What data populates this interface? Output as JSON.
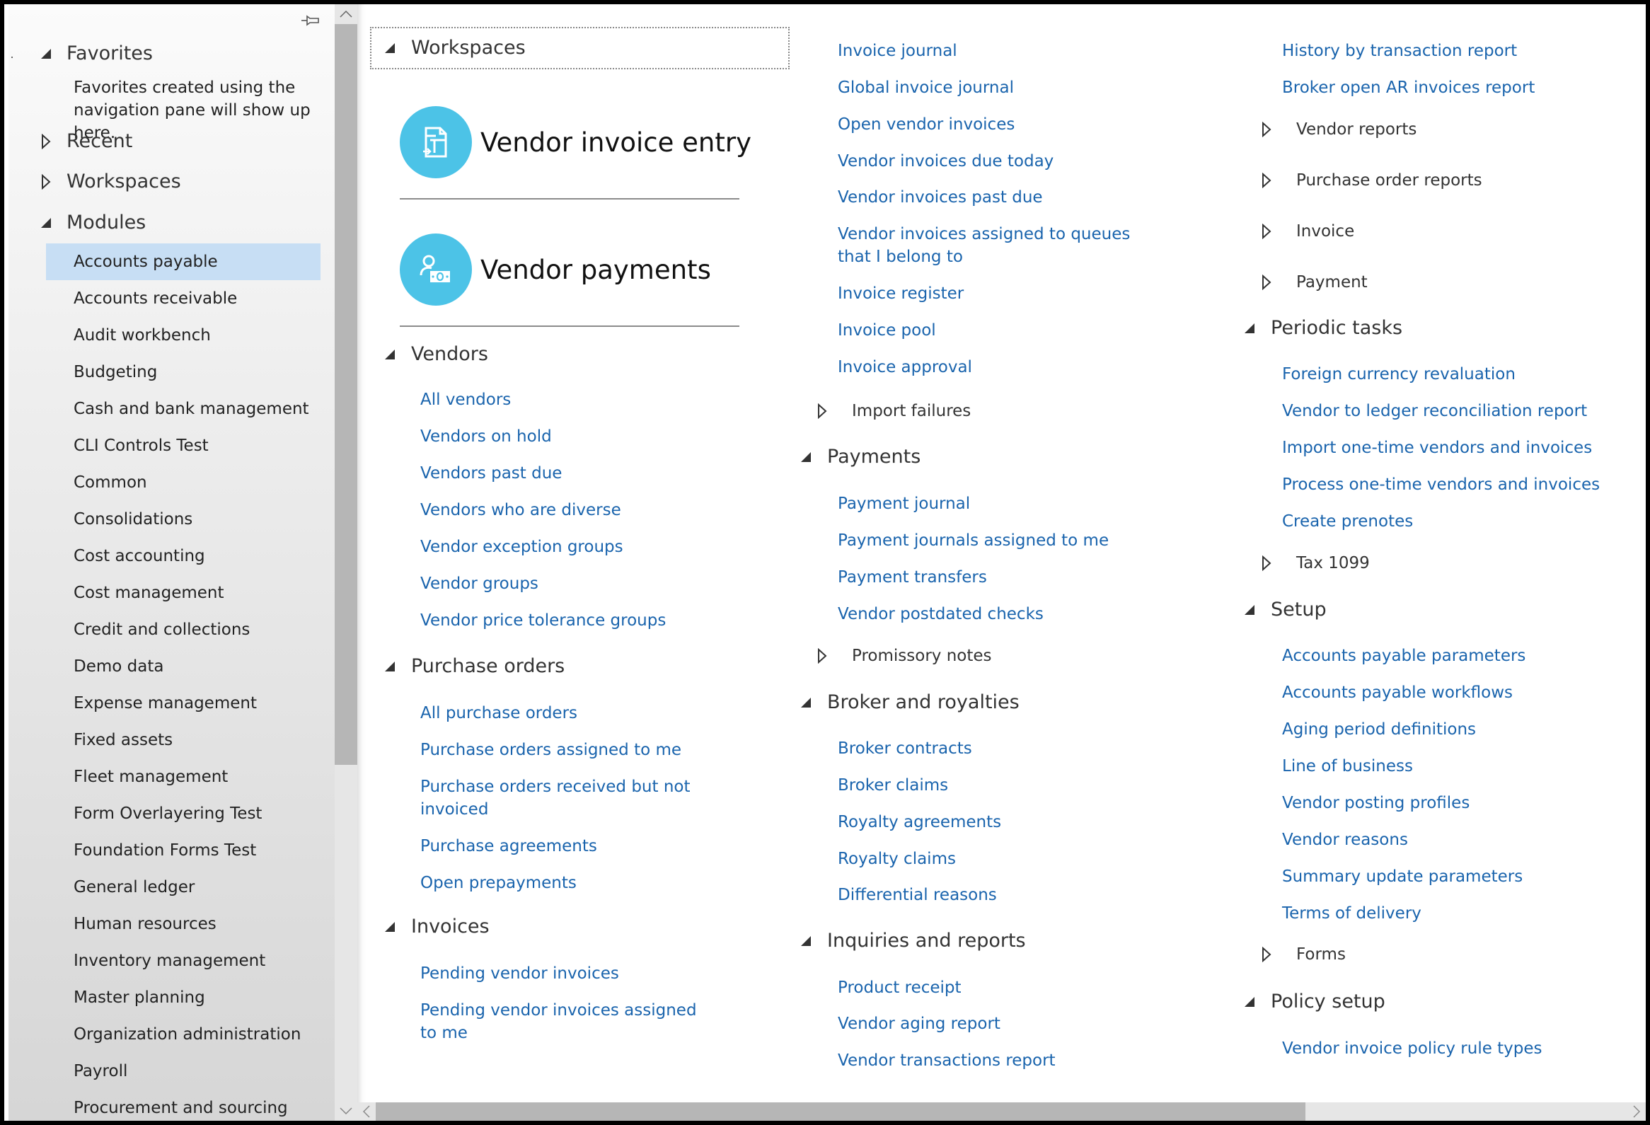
{
  "nav": {
    "pin_icon": "pin-icon",
    "sections": {
      "favorites": {
        "label": "Favorites",
        "expanded": true,
        "hint": "Favorites created using the navigation pane will show up here."
      },
      "recent": {
        "label": "Recent",
        "expanded": false
      },
      "workspaces": {
        "label": "Workspaces",
        "expanded": false
      },
      "modules": {
        "label": "Modules",
        "expanded": true
      }
    },
    "selected_module": "Accounts payable",
    "modules": [
      "Accounts payable",
      "Accounts receivable",
      "Audit workbench",
      "Budgeting",
      "Cash and bank management",
      "CLI Controls Test",
      "Common",
      "Consolidations",
      "Cost accounting",
      "Cost management",
      "Credit and collections",
      "Demo data",
      "Expense management",
      "Fixed assets",
      "Fleet management",
      "Form Overlayering Test",
      "Foundation Forms Test",
      "General ledger",
      "Human resources",
      "Inventory management",
      "Master planning",
      "Organization administration",
      "Payroll",
      "Procurement and sourcing"
    ]
  },
  "main": {
    "workspaces": {
      "label": "Workspaces",
      "tiles": [
        {
          "label": "Vendor invoice entry",
          "icon": "invoice-entry-icon"
        },
        {
          "label": "Vendor payments",
          "icon": "vendor-payment-icon"
        }
      ]
    },
    "vendors": {
      "label": "Vendors",
      "links": [
        "All vendors",
        "Vendors on hold",
        "Vendors past due",
        "Vendors who are diverse",
        "Vendor exception groups",
        "Vendor groups",
        "Vendor price tolerance groups"
      ]
    },
    "purchase_orders": {
      "label": "Purchase orders",
      "links": [
        "All purchase orders",
        "Purchase orders assigned to me",
        "Purchase orders received but not invoiced",
        "Purchase agreements",
        "Open prepayments"
      ]
    },
    "invoices": {
      "label": "Invoices",
      "links": [
        "Pending vendor invoices",
        "Pending vendor invoices assigned to me"
      ]
    },
    "invoices_cont": {
      "links": [
        "Invoice journal",
        "Global invoice journal",
        "Open vendor invoices",
        "Vendor invoices due today",
        "Vendor invoices past due",
        "Vendor invoices assigned to queues that I belong to",
        "Invoice register",
        "Invoice pool",
        "Invoice approval"
      ],
      "subgroups": [
        "Import failures"
      ]
    },
    "payments": {
      "label": "Payments",
      "links": [
        "Payment journal",
        "Payment journals assigned to me",
        "Payment transfers",
        "Vendor postdated checks"
      ],
      "subgroups": [
        "Promissory notes"
      ]
    },
    "broker": {
      "label": "Broker and royalties",
      "links": [
        "Broker contracts",
        "Broker claims",
        "Royalty agreements",
        "Royalty claims",
        "Differential reasons"
      ]
    },
    "inquiries": {
      "label": "Inquiries and reports",
      "links": [
        "Product receipt",
        "Vendor aging report",
        "Vendor transactions report"
      ]
    },
    "inquiries_cont": {
      "links": [
        "History by transaction report",
        "Broker open AR invoices report"
      ],
      "subgroups": [
        "Vendor reports",
        "Purchase order reports",
        "Invoice",
        "Payment"
      ]
    },
    "periodic": {
      "label": "Periodic tasks",
      "links": [
        "Foreign currency revaluation",
        "Vendor to ledger reconciliation report",
        "Import one-time vendors and invoices",
        "Process one-time vendors and invoices",
        "Create prenotes"
      ],
      "subgroups": [
        "Tax 1099"
      ]
    },
    "setup": {
      "label": "Setup",
      "links": [
        "Accounts payable parameters",
        "Accounts payable workflows",
        "Aging period definitions",
        "Line of business",
        "Vendor posting profiles",
        "Vendor reasons",
        "Summary update parameters",
        "Terms of delivery"
      ],
      "subgroups": [
        "Forms"
      ]
    },
    "policy": {
      "label": "Policy setup",
      "links": [
        "Vendor invoice policy rule types"
      ]
    }
  },
  "colors": {
    "link": "#1a64ad",
    "tile_circle": "#4cc3e7",
    "selected_bg": "#c7def4",
    "scroll_thumb": "#b6b6b6",
    "scroll_track": "#e6e6e6"
  }
}
